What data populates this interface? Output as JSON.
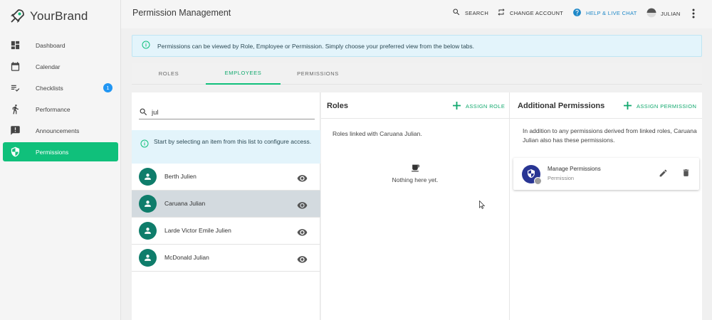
{
  "brand": {
    "name": "YourBrand"
  },
  "sidebar": {
    "items": [
      {
        "label": "Dashboard",
        "icon": "dashboard-icon"
      },
      {
        "label": "Calendar",
        "icon": "calendar-icon"
      },
      {
        "label": "Checklists",
        "icon": "checklist-icon",
        "badge": "1"
      },
      {
        "label": "Performance",
        "icon": "running-icon"
      },
      {
        "label": "Announcements",
        "icon": "announcement-icon"
      },
      {
        "label": "Permissions",
        "icon": "shield-icon",
        "active": true
      }
    ]
  },
  "header": {
    "title": "Permission Management",
    "search": "SEARCH",
    "change_account": "CHANGE ACCOUNT",
    "help": "HELP & LIVE CHAT",
    "user": "JULIAN"
  },
  "banner": {
    "text": "Permissions can be viewed by Role, Employee or Permission. Simply choose your preferred view from the below tabs."
  },
  "tabs": [
    {
      "label": "ROLES"
    },
    {
      "label": "EMPLOYEES",
      "active": true
    },
    {
      "label": "PERMISSIONS"
    }
  ],
  "employees_panel": {
    "search_value": "jul",
    "hint": "Start by selecting an item from this list to configure access.",
    "items": [
      {
        "name": "Berth Julien"
      },
      {
        "name": "Caruana Julian",
        "selected": true
      },
      {
        "name": "Larde Victor Emile Julien"
      },
      {
        "name": "McDonald Julian"
      }
    ]
  },
  "roles_panel": {
    "title": "Roles",
    "assign_label": "ASSIGN ROLE",
    "linked_text": "Roles linked with Caruana Julian.",
    "empty_text": "Nothing here yet."
  },
  "additional_panel": {
    "title": "Additional Permissions",
    "assign_label": "ASSIGN PERMISSION",
    "description": "In addition to any permissions derived from linked roles, Caruana Julian also has these permissions.",
    "permissions": [
      {
        "name": "Manage Permissions",
        "type": "Permission"
      }
    ]
  },
  "colors": {
    "accent": "#10c07b",
    "info_bg": "#e3f4fb",
    "avatar": "#0f7d6b",
    "help_link": "#1e88c8",
    "badge": "#2196f3"
  }
}
